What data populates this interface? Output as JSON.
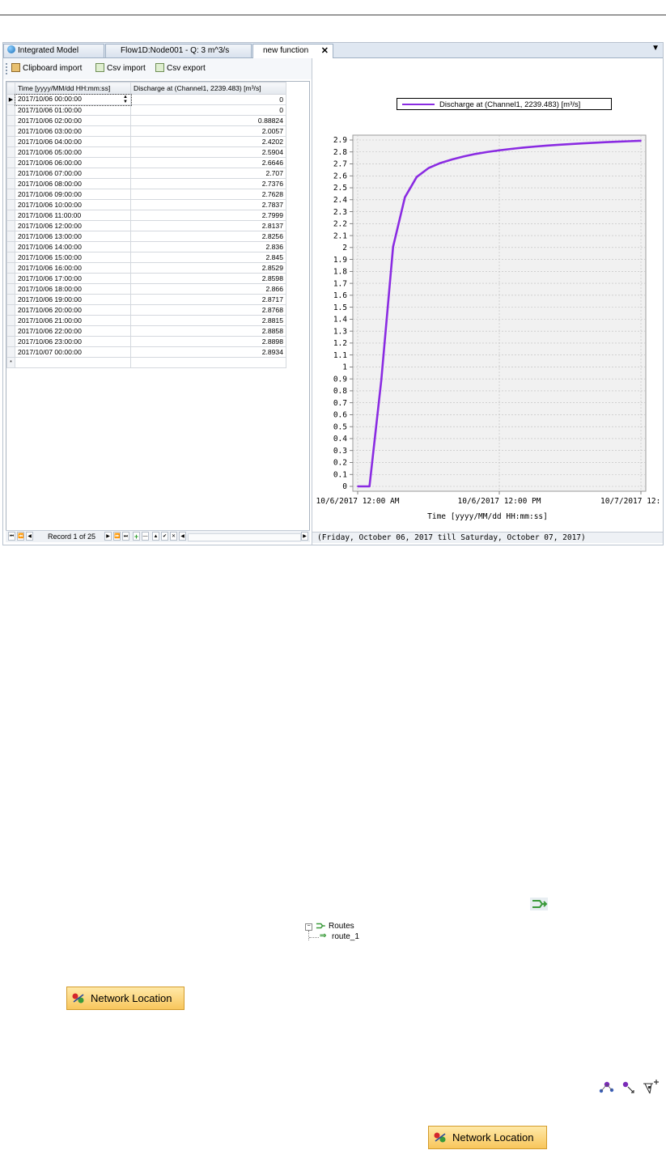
{
  "tabs": [
    {
      "label": "Integrated Model",
      "active": false,
      "icon": "globe-icon"
    },
    {
      "label": "Flow1D:Node001 - Q: 3 m^3/s",
      "active": false
    },
    {
      "label": "new function",
      "active": true
    }
  ],
  "tab_close": "✕",
  "tab_menu": "▼",
  "toolbar": {
    "clipboard_import": "Clipboard import",
    "csv_import": "Csv import",
    "csv_export": "Csv export"
  },
  "grid": {
    "columns": [
      "Time [yyyy/MM/dd HH:mm:ss]",
      "Discharge at (Channel1, 2239.483) [m³/s]"
    ],
    "rows": [
      [
        "2017/10/06 00:00:00",
        "0"
      ],
      [
        "2017/10/06 01:00:00",
        "0"
      ],
      [
        "2017/10/06 02:00:00",
        "0.88824"
      ],
      [
        "2017/10/06 03:00:00",
        "2.0057"
      ],
      [
        "2017/10/06 04:00:00",
        "2.4202"
      ],
      [
        "2017/10/06 05:00:00",
        "2.5904"
      ],
      [
        "2017/10/06 06:00:00",
        "2.6646"
      ],
      [
        "2017/10/06 07:00:00",
        "2.707"
      ],
      [
        "2017/10/06 08:00:00",
        "2.7376"
      ],
      [
        "2017/10/06 09:00:00",
        "2.7628"
      ],
      [
        "2017/10/06 10:00:00",
        "2.7837"
      ],
      [
        "2017/10/06 11:00:00",
        "2.7999"
      ],
      [
        "2017/10/06 12:00:00",
        "2.8137"
      ],
      [
        "2017/10/06 13:00:00",
        "2.8256"
      ],
      [
        "2017/10/06 14:00:00",
        "2.836"
      ],
      [
        "2017/10/06 15:00:00",
        "2.845"
      ],
      [
        "2017/10/06 16:00:00",
        "2.8529"
      ],
      [
        "2017/10/06 17:00:00",
        "2.8598"
      ],
      [
        "2017/10/06 18:00:00",
        "2.866"
      ],
      [
        "2017/10/06 19:00:00",
        "2.8717"
      ],
      [
        "2017/10/06 20:00:00",
        "2.8768"
      ],
      [
        "2017/10/06 21:00:00",
        "2.8815"
      ],
      [
        "2017/10/06 22:00:00",
        "2.8858"
      ],
      [
        "2017/10/06 23:00:00",
        "2.8898"
      ],
      [
        "2017/10/07 00:00:00",
        "2.8934"
      ]
    ],
    "current_row_marker": "▶",
    "new_row_marker": "*"
  },
  "navigator": {
    "record_text": "Record 1 of 25",
    "first": "⏮",
    "prev_page": "⏪",
    "prev": "◀",
    "next": "▶",
    "next_page": "⏩",
    "last": "⏭",
    "add": "+",
    "remove": "—",
    "up": "▲",
    "apply": "✔",
    "cancel": "✕",
    "scroll_left": "◀",
    "scroll_right": "▶"
  },
  "chart_data": {
    "type": "line",
    "series": [
      {
        "name": "Discharge at (Channel1, 2239.483) [m³/s]",
        "color": "#8a2be2",
        "x": [
          0,
          1,
          2,
          3,
          4,
          5,
          6,
          7,
          8,
          9,
          10,
          11,
          12,
          13,
          14,
          15,
          16,
          17,
          18,
          19,
          20,
          21,
          22,
          23,
          24
        ],
        "values": [
          0,
          0,
          0.88824,
          2.0057,
          2.4202,
          2.5904,
          2.6646,
          2.707,
          2.7376,
          2.7628,
          2.7837,
          2.7999,
          2.8137,
          2.8256,
          2.836,
          2.845,
          2.8529,
          2.8598,
          2.866,
          2.8717,
          2.8768,
          2.8815,
          2.8858,
          2.8898,
          2.8934
        ]
      }
    ],
    "xlabel": "Time [yyyy/MM/dd HH:mm:ss]",
    "x_ticks": [
      {
        "x": 0,
        "label": "10/6/2017 12:00 AM"
      },
      {
        "x": 12,
        "label": "10/6/2017 12:00 PM"
      },
      {
        "x": 24,
        "label": "10/7/2017 12:"
      }
    ],
    "xlim": [
      0,
      24
    ],
    "ylim": [
      0,
      2.9
    ],
    "y_ticks": [
      "0",
      "0.1",
      "0.2",
      "0.3",
      "0.4",
      "0.5",
      "0.6",
      "0.7",
      "0.8",
      "0.9",
      "1",
      "1.1",
      "1.2",
      "1.3",
      "1.4",
      "1.5",
      "1.6",
      "1.7",
      "1.8",
      "1.9",
      "2",
      "2.1",
      "2.2",
      "2.3",
      "2.4",
      "2.5",
      "2.6",
      "2.7",
      "2.8",
      "2.9"
    ],
    "grid": true,
    "legend": "top-center",
    "date_range": "(Friday, October 06, 2017 till Saturday, October 07, 2017)"
  },
  "tree": {
    "expander": "−",
    "root": "Routes",
    "child": "route_1",
    "child_icon": "⇒"
  },
  "network_location_label": "Network Location"
}
